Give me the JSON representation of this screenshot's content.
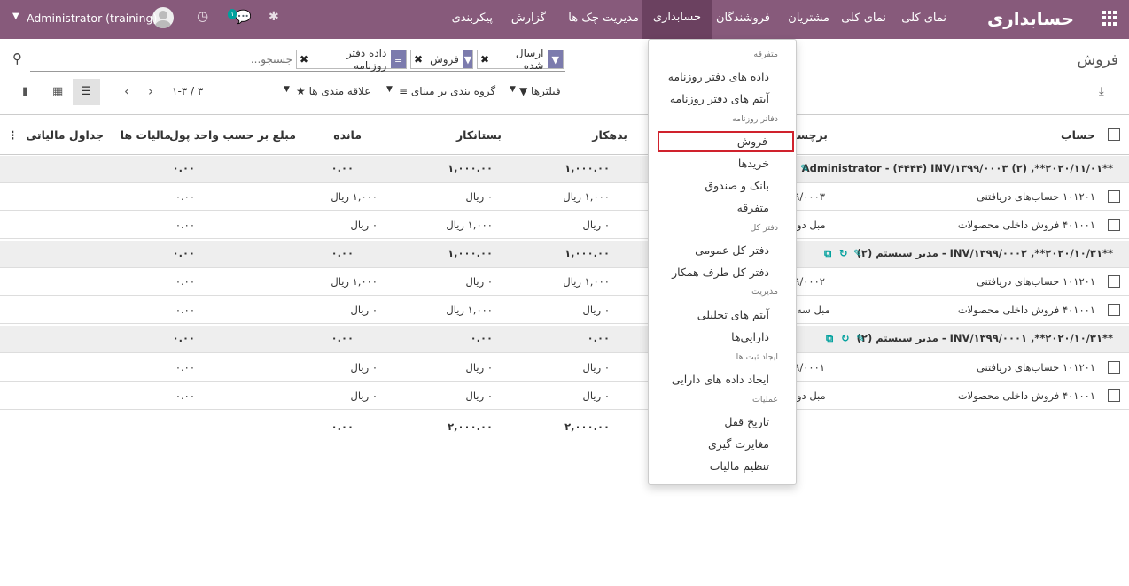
{
  "topbar": {
    "app_title": "حسابداری",
    "menus": [
      "نمای کلی",
      "نمای کلی",
      "مشتریان",
      "فروشندگان",
      "حسابداری",
      "مدیریت چک ها",
      "گزارش",
      "پیکربندی"
    ],
    "user": "Administrator (training)",
    "chat_count": "۱"
  },
  "control": {
    "breadcrumb": "فروش",
    "facets": [
      {
        "label": "ارسال شده",
        "icon": "filter-icon"
      },
      {
        "label": "فروش",
        "icon": "filter-icon"
      },
      {
        "label": "داده دفتر روزنامه",
        "icon": "groupby-icon"
      }
    ],
    "search_placeholder": "جستجو...",
    "filters": "فیلترها",
    "groupby": "گروه بندی بر مبنای",
    "favorites": "علاقه مندی ها",
    "pager": "۱-۳ / ۳"
  },
  "table": {
    "headers": [
      "حساب",
      "برچسب",
      "بدهکار",
      "بستانکار",
      "مانده",
      "مبلغ بر حسب واحد پول",
      "مالیات ها",
      "جداول مالیاتی"
    ],
    "groups": [
      {
        "title": "**۲۰۲۰/۱۱/۰۱**, (۲) Administrator - (۴۴۴۴) INV/۱۳۹۹/۰۰۰۳",
        "debit": "۱,۰۰۰.۰۰",
        "credit": "۱,۰۰۰.۰۰",
        "balance": "۰.۰۰",
        "tax": "۰.۰۰",
        "rows": [
          {
            "account": "۱۰۱۲۰۱ حساب‌های دریافتنی",
            "label": "۹۹/۰۰۰۳",
            "debit": "۱,۰۰۰ ریال",
            "credit": "۰ ریال",
            "balance": "۱,۰۰۰ ریال",
            "tax": "۰.۰۰"
          },
          {
            "account": "۴۰۱۰۰۱ فروش داخلی محصولات",
            "label": "مبل دو",
            "debit": "۰ ریال",
            "credit": "۱,۰۰۰ ریال",
            "balance": "۰ ریال",
            "tax": "۰.۰۰"
          }
        ]
      },
      {
        "title": "**۲۰۲۰/۱۰/۳۱**, INV/۱۳۹۹/۰۰۰۲ - مدیر سیستم (۲)",
        "debit": "۱,۰۰۰.۰۰",
        "credit": "۱,۰۰۰.۰۰",
        "balance": "۰.۰۰",
        "tax": "۰.۰۰",
        "rows": [
          {
            "account": "۱۰۱۲۰۱ حساب‌های دریافتنی",
            "label": "۹۹/۰۰۰۲",
            "debit": "۱,۰۰۰ ریال",
            "credit": "۰ ریال",
            "balance": "۱,۰۰۰ ریال",
            "tax": "۰.۰۰"
          },
          {
            "account": "۴۰۱۰۰۱ فروش داخلی محصولات",
            "label": "مبل سه",
            "debit": "۰ ریال",
            "credit": "۱,۰۰۰ ریال",
            "balance": "۰ ریال",
            "tax": "۰.۰۰"
          }
        ]
      },
      {
        "title": "**۲۰۲۰/۱۰/۳۱**, INV/۱۳۹۹/۰۰۰۱ - مدیر سیستم (۲)",
        "debit": "۰.۰۰",
        "credit": "۰.۰۰",
        "balance": "۰.۰۰",
        "tax": "۰.۰۰",
        "rows": [
          {
            "account": "۱۰۱۲۰۱ حساب‌های دریافتنی",
            "label": "۹۹/۰۰۰۱",
            "debit": "۰ ریال",
            "credit": "۰ ریال",
            "balance": "۰ ریال",
            "tax": "۰.۰۰"
          },
          {
            "account": "۴۰۱۰۰۱ فروش داخلی محصولات",
            "label": "مبل دو",
            "debit": "۰ ریال",
            "credit": "۰ ریال",
            "balance": "۰ ریال",
            "tax": "۰.۰۰"
          }
        ]
      }
    ],
    "totals": {
      "debit": "۲,۰۰۰.۰۰",
      "credit": "۲,۰۰۰.۰۰",
      "balance": "۰.۰۰"
    }
  },
  "dropdown": {
    "items": [
      {
        "type": "header",
        "label": "متفرقه"
      },
      {
        "type": "item",
        "label": "داده های دفتر روزنامه"
      },
      {
        "type": "item",
        "label": "آیتم های دفتر روزنامه"
      },
      {
        "type": "header",
        "label": "دفاتر روزنامه"
      },
      {
        "type": "item",
        "label": "فروش"
      },
      {
        "type": "item",
        "label": "خریدها"
      },
      {
        "type": "item",
        "label": "بانک و صندوق"
      },
      {
        "type": "item",
        "label": "متفرقه"
      },
      {
        "type": "header",
        "label": "دفتر کل"
      },
      {
        "type": "item",
        "label": "دفتر کل عمومی"
      },
      {
        "type": "item",
        "label": "دفتر کل طرف همکار"
      },
      {
        "type": "header",
        "label": "مدیریت"
      },
      {
        "type": "item",
        "label": "آیتم های تحلیلی"
      },
      {
        "type": "item",
        "label": "دارایی‌ها"
      },
      {
        "type": "header",
        "label": "ایجاد ثبت ها"
      },
      {
        "type": "item",
        "label": "ایجاد داده های دارایی"
      },
      {
        "type": "header",
        "label": "عملیات"
      },
      {
        "type": "item",
        "label": "تاریخ قفل"
      },
      {
        "type": "item",
        "label": "مغایرت گیری"
      },
      {
        "type": "item",
        "label": "تنظیم مالیات"
      }
    ]
  }
}
